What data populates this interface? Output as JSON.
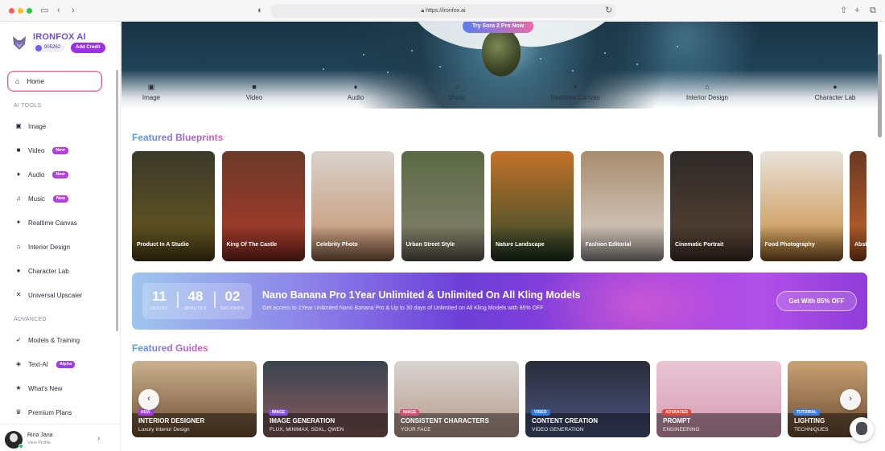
{
  "browser": {
    "url": "https://ironfox.ai",
    "icons": [
      "sidebar-toggle-icon",
      "back-icon",
      "forward-icon",
      "shield-icon",
      "lock-icon",
      "reload-icon",
      "share-icon",
      "new-tab-icon",
      "tabs-icon"
    ]
  },
  "sidebar": {
    "brand": "IRONFOX AI",
    "credits": "905262",
    "add_credit": "Add Credit",
    "home": "Home",
    "section_tools": "AI TOOLS",
    "tools": [
      {
        "label": "Image",
        "icon": "image-icon"
      },
      {
        "label": "Video",
        "icon": "video-icon",
        "tag": "New"
      },
      {
        "label": "Audio",
        "icon": "microphone-icon",
        "tag": "New"
      },
      {
        "label": "Music",
        "icon": "music-icon",
        "tag": "New"
      },
      {
        "label": "Realtime Canvas",
        "icon": "magic-wand-icon"
      },
      {
        "label": "Interior Design",
        "icon": "house-icon"
      },
      {
        "label": "Character Lab",
        "icon": "person-icon"
      },
      {
        "label": "Universal Upscaler",
        "icon": "expand-icon"
      }
    ],
    "section_advanced": "ADVANCED",
    "advanced": [
      {
        "label": "Models & Training",
        "icon": "rocket-icon"
      },
      {
        "label": "Text-AI",
        "icon": "gamepad-icon",
        "tag": "Alpha"
      },
      {
        "label": "What's New",
        "icon": "star-icon"
      },
      {
        "label": "Premium Plans",
        "icon": "crown-icon"
      }
    ],
    "profile": {
      "name": "Rina Jana",
      "sub": "View Profile"
    }
  },
  "hero": {
    "try_button": "Try Sora 2 Pro Now",
    "tools": [
      {
        "label": "Image",
        "icon": "image-icon"
      },
      {
        "label": "Video",
        "icon": "video-icon"
      },
      {
        "label": "Audio",
        "icon": "microphone-icon"
      },
      {
        "label": "Music",
        "icon": "music-icon"
      },
      {
        "label": "Realtime Canvas",
        "icon": "magic-wand-icon"
      },
      {
        "label": "Interior Design",
        "icon": "house-icon"
      },
      {
        "label": "Character Lab",
        "icon": "person-icon"
      }
    ]
  },
  "blueprints": {
    "title": "Featured Blueprints",
    "items": [
      {
        "label": "Product In A Studio",
        "color_top": "#3b3a2a",
        "color_bottom": "#6b5a1e"
      },
      {
        "label": "King Of The Castle",
        "color_top": "#6a3a28",
        "color_bottom": "#b03b2c"
      },
      {
        "label": "Celebrity Photo",
        "color_top": "#d8d2cc",
        "color_bottom": "#c58f6a"
      },
      {
        "label": "Urban Street Style",
        "color_top": "#5a6a44",
        "color_bottom": "#8a8472"
      },
      {
        "label": "Nature Landscape",
        "color_top": "#c3722a",
        "color_bottom": "#2f4a2c"
      },
      {
        "label": "Fashion Editorial",
        "color_top": "#a88c6e",
        "color_bottom": "#ded6d0"
      },
      {
        "label": "Cinematic Portrait",
        "color_top": "#2e2a28",
        "color_bottom": "#5b4535"
      },
      {
        "label": "Food Photography",
        "color_top": "#e8e2da",
        "color_bottom": "#c78a3a"
      },
      {
        "label": "Abst",
        "color_top": "#6a3a24",
        "color_bottom": "#c8662a"
      }
    ]
  },
  "promo": {
    "timer": [
      {
        "value": "11",
        "label": "HOURS"
      },
      {
        "value": "48",
        "label": "MINUTES"
      },
      {
        "value": "02",
        "label": "SECONDS"
      }
    ],
    "title": "Nano Banana Pro 1Year Unlimited & Unlimited On All Kling Models",
    "subtitle": "Get access to 1Year Unlimited Nano Banana Pro & Up to 30 days of Unlimited on All Kling Models with 85% OFF",
    "button": "Get With 85% OFF"
  },
  "guides": {
    "title": "Featured Guides",
    "items": [
      {
        "badge": "NEW",
        "badge_color": "#a53ae6",
        "title": "INTERIOR DESIGNER",
        "sub": "Luxury Interior Design",
        "color_top": "#c9b08e",
        "color_bottom": "#6e4e32"
      },
      {
        "badge": "IMAGE",
        "badge_color": "#8a4fe6",
        "title": "IMAGE GENERATION",
        "sub": "FLUX, MINIMAX, SDXL, QWEN",
        "color_top": "#3a4450",
        "color_bottom": "#8a5c5c"
      },
      {
        "badge": "IMAGE",
        "badge_color": "#d94f78",
        "title": "CONSISTENT CHARACTERS",
        "sub": "YOUR FACE",
        "color_top": "#d8d4d0",
        "color_bottom": "#b89a8c"
      },
      {
        "badge": "VIDEO",
        "badge_color": "#2f7be6",
        "title": "CONTENT CREATION",
        "sub": "VIDEO GENERATION",
        "color_top": "#2a2c3a",
        "color_bottom": "#4a5680"
      },
      {
        "badge": "ADVANCED",
        "badge_color": "#e0453a",
        "title": "PROMPT",
        "sub": "ENGINEERING",
        "color_top": "#eac6d4",
        "color_bottom": "#d49ab4"
      },
      {
        "badge": "TUTORIAL",
        "badge_color": "#3a7ee6",
        "title": "LIGHTING",
        "sub": "TECHNIQUES",
        "color_top": "#caa274",
        "color_bottom": "#6a4a30"
      }
    ]
  }
}
